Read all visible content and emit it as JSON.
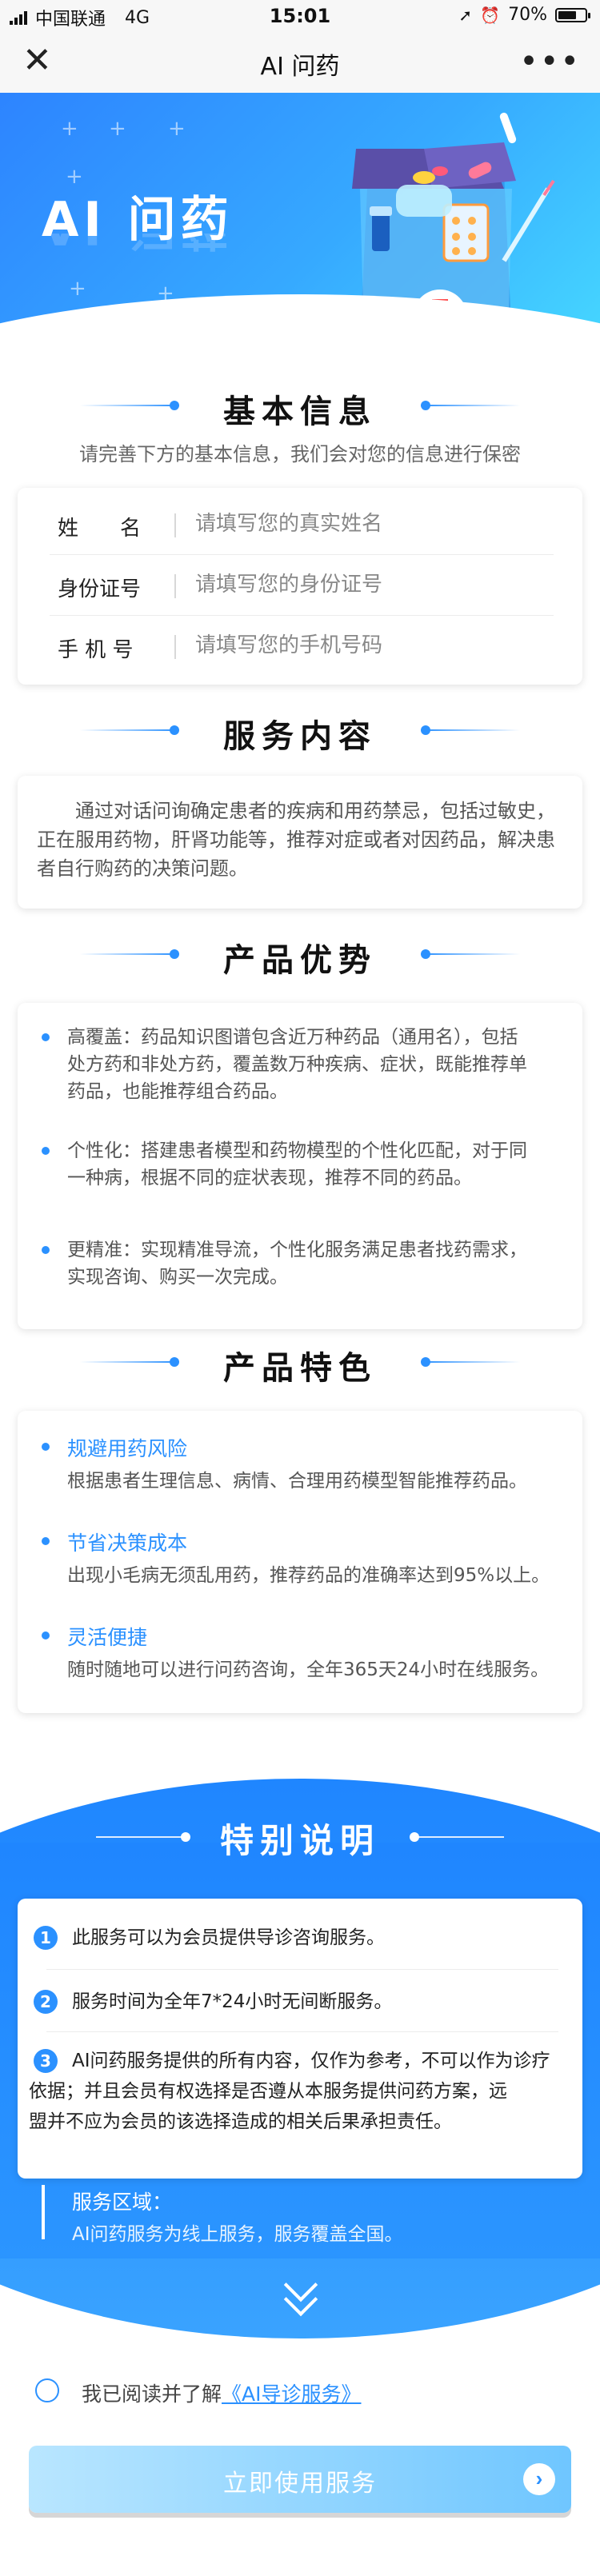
{
  "status_bar": {
    "carrier": "中国联通",
    "network": "4G",
    "time": "15:01",
    "battery": "70%",
    "battery_level": 0.7
  },
  "nav": {
    "title": "AI 问药",
    "close_icon": "close-icon",
    "more_icon": "more-icon"
  },
  "hero": {
    "title": "AI 问药"
  },
  "basic_info": {
    "heading": "基本信息",
    "subtitle": "请完善下方的基本信息，我们会对您的信息进行保密",
    "fields": [
      {
        "label": "姓　　名",
        "placeholder": "请填写您的真实姓名",
        "value": ""
      },
      {
        "label": "身份证号",
        "placeholder": "请填写您的身份证号",
        "value": ""
      },
      {
        "label": "手 机 号",
        "placeholder": "请填写您的手机号码",
        "value": ""
      }
    ]
  },
  "service_content": {
    "heading": "服务内容",
    "lines": [
      "　　通过对话问询确定患者的疾病和用药禁忌，包括过敏史，",
      "正在服用药物，肝肾功能等，推荐对症或者对因药品，解决患",
      "者自行购药的决策问题。"
    ]
  },
  "advantages": {
    "heading": "产品优势",
    "items": [
      {
        "lines": [
          "高覆盖：药品知识图谱包含近万种药品（通用名），包括",
          "处方药和非处方药，覆盖数万种疾病、症状，既能推荐单",
          "药品，也能推荐组合药品。"
        ]
      },
      {
        "lines": [
          "个性化：搭建患者模型和药物模型的个性化匹配，对于同",
          "一种病，根据不同的症状表现，推荐不同的药品。"
        ]
      },
      {
        "lines": [
          "更精准：实现精准导流，个性化服务满足患者找药需求，",
          "实现咨询、购买一次完成。"
        ]
      }
    ]
  },
  "features": {
    "heading": "产品特色",
    "items": [
      {
        "title": "规避用药风险",
        "desc": "根据患者生理信息、病情、合理用药模型智能推荐药品。"
      },
      {
        "title": "节省决策成本",
        "desc": "出现小毛病无须乱用药，推荐药品的准确率达到95%以上。"
      },
      {
        "title": "灵活便捷",
        "desc": "随时随地可以进行问药咨询，全年365天24小时在线服务。"
      }
    ]
  },
  "special": {
    "heading": "特别说明",
    "items": [
      {
        "num": "1",
        "lines": [
          "此服务可以为会员提供导诊咨询服务。"
        ]
      },
      {
        "num": "2",
        "lines": [
          "服务时间为全年7*24小时无间断服务。"
        ]
      },
      {
        "num": "3",
        "lines": [
          "AI问药服务提供的所有内容，仅作为参考，不可以作为诊疗",
          "依据；并且会员有权选择是否遵从本服务提供问药方案，远",
          "盟并不应为会员的该选择造成的相关后果承担责任。"
        ]
      }
    ],
    "region_label": "服务区域：",
    "region_text": "AI问药服务为线上服务，服务覆盖全国。"
  },
  "agreement": {
    "prefix": "我已阅读并了解",
    "link": "《AI导诊服务》",
    "checked": false
  },
  "cta": {
    "label": "立即使用服务"
  },
  "colors": {
    "accent": "#2b91ff",
    "hero_start": "#2d84ff",
    "hero_end": "#46d8ff"
  }
}
